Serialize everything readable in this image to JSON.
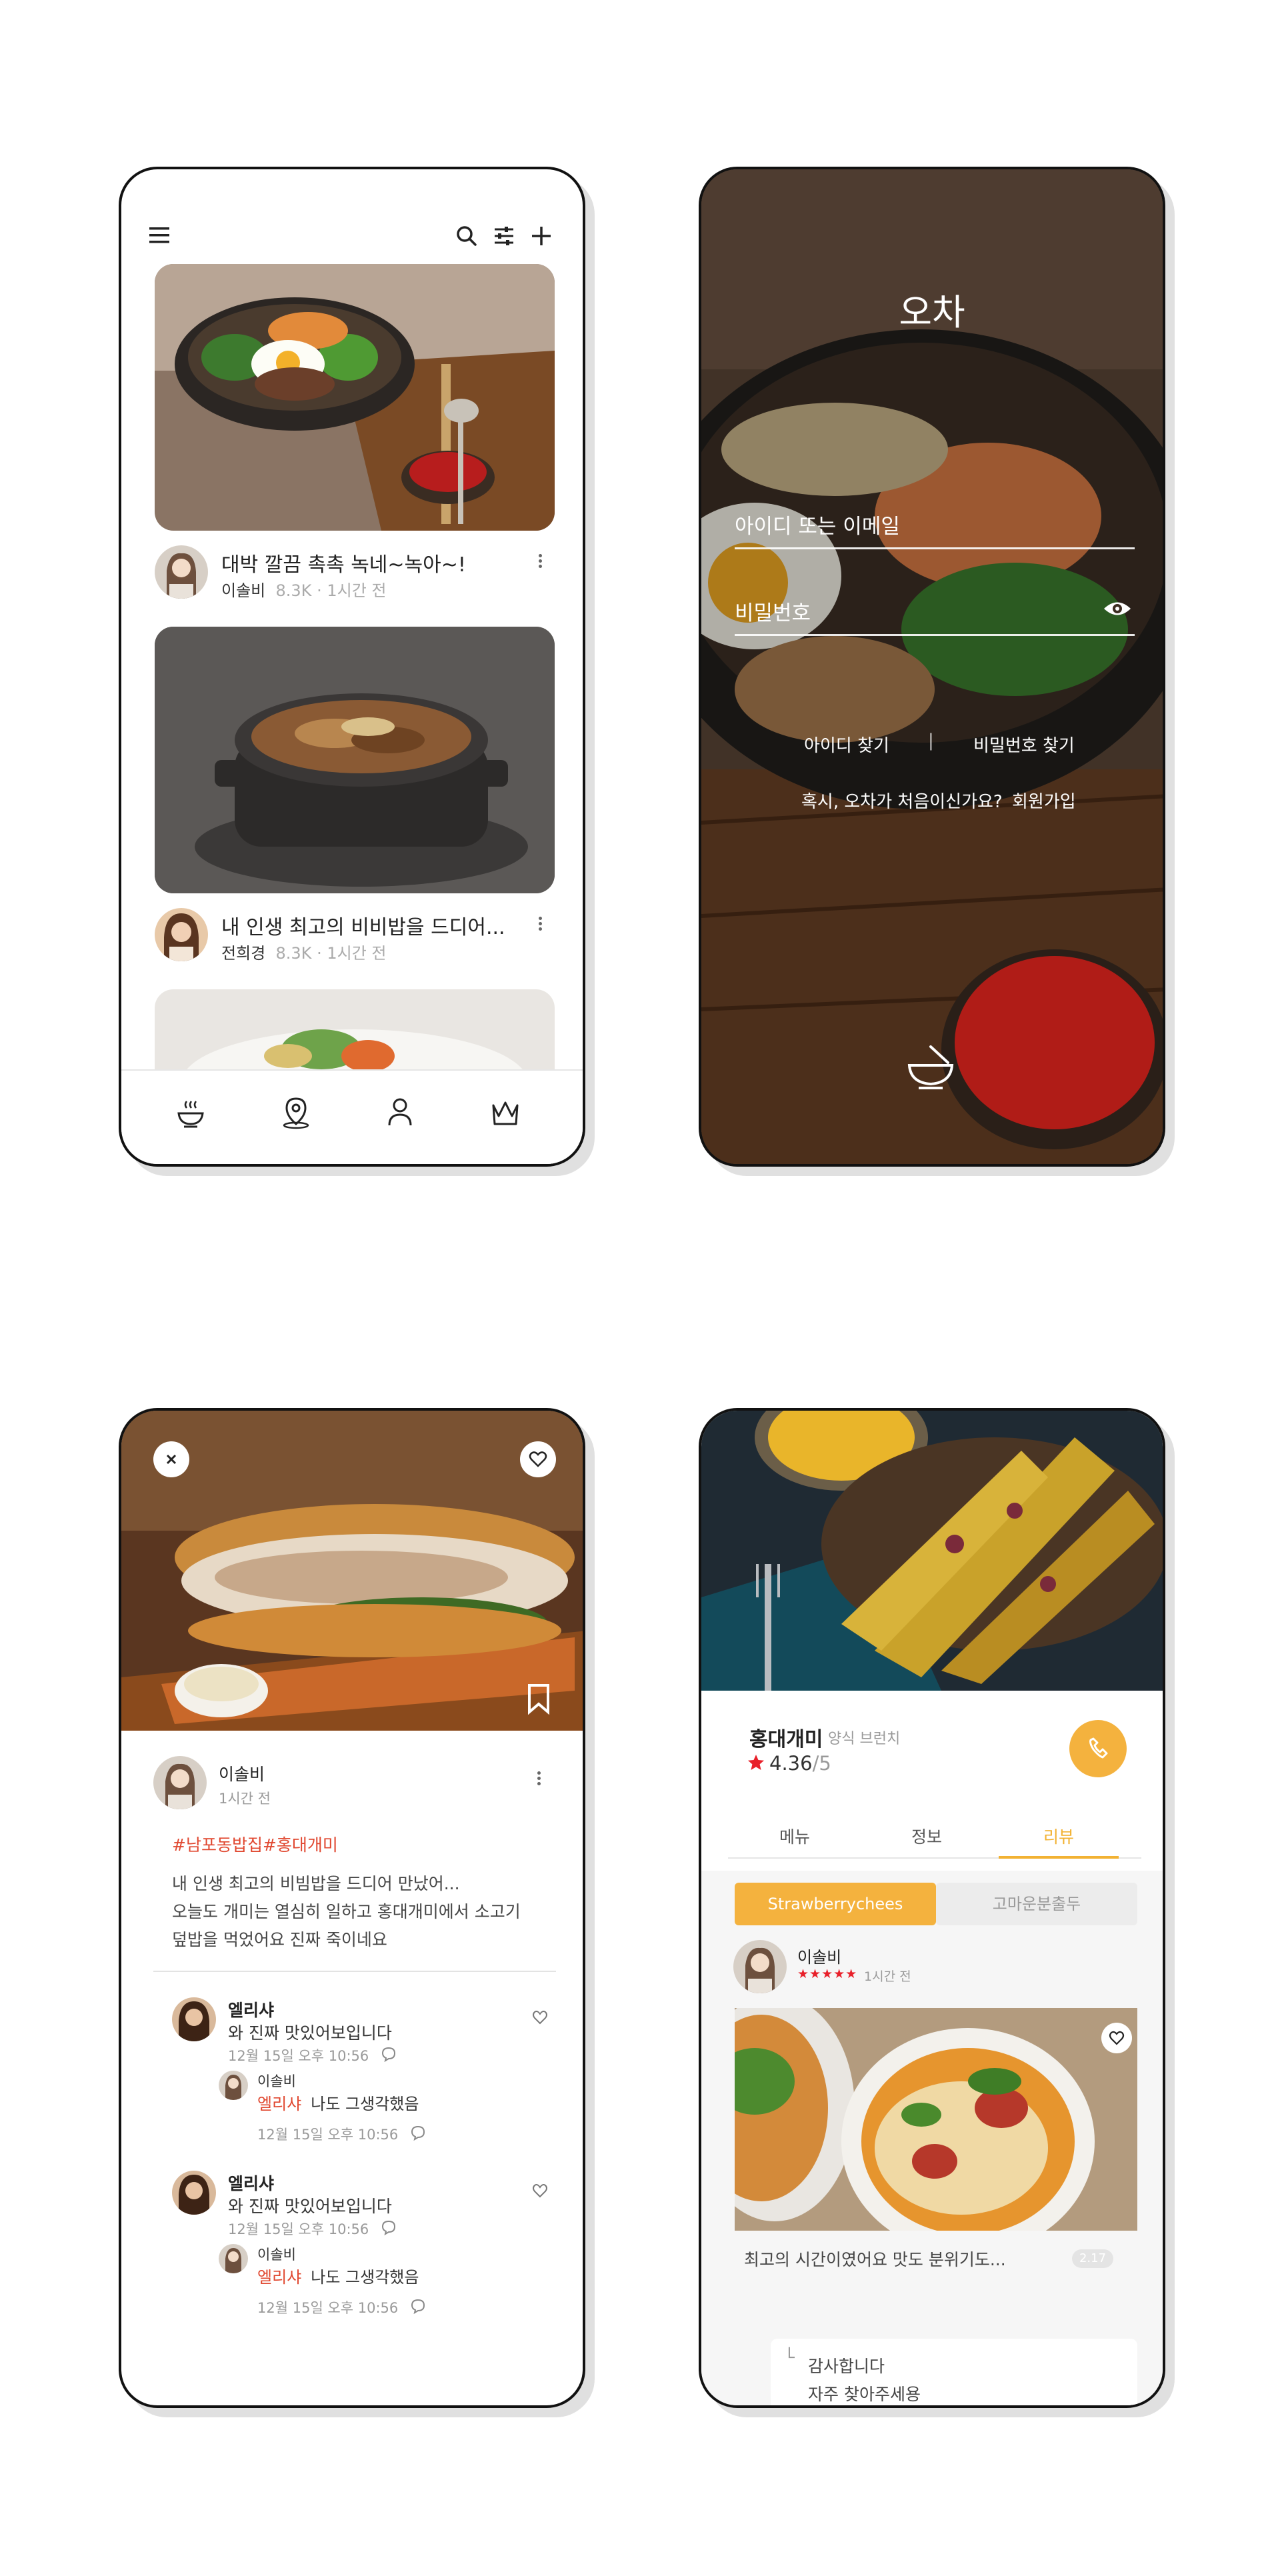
{
  "colors": {
    "accent": "#f4b23e",
    "tag_red": "#e0472f",
    "star_red": "#e8202a",
    "tab_active": "#f2b233"
  },
  "feed": {
    "icons": [
      "menu-icon",
      "search-icon",
      "filter-icon",
      "plus-icon"
    ],
    "posts": [
      {
        "title": "대박 깔끔 촉촉 녹네~녹아~!",
        "author": "이솔비",
        "views": "8.3K",
        "sep": "·",
        "time": "1시간 전"
      },
      {
        "title": "내 인생 최고의 비비밥을 드디어...",
        "author": "전희경",
        "views": "8.3K",
        "sep": "·",
        "time": "1시간 전"
      }
    ],
    "nav": [
      "bowl-icon",
      "map-pin-icon",
      "person-icon",
      "crown-icon"
    ]
  },
  "login": {
    "app_title": "오차",
    "id_placeholder": "아이디 또는 이메일",
    "pw_placeholder": "비밀번호",
    "find_id": "아이디 찾기",
    "divider": "|",
    "find_pw": "비밀번호 찾기",
    "first_time": "혹시, 오차가 처음이신가요?",
    "signup": "회원가입"
  },
  "post": {
    "author": "이솔비",
    "time": "1시간 전",
    "tag1": "#남포동밥집",
    "tag2": "#홍대개미",
    "body": [
      "내 인생 최고의 비빔밥을 드디어 만났어...",
      "오늘도 개미는 열심히 일하고 홍대개미에서 소고기",
      "덮밥을 먹었어요 진짜 죽이네요"
    ],
    "comments": [
      {
        "name": "엘리샤",
        "text": "와 진짜 맛있어보입니다",
        "time": "12월 15일 오후 10:56",
        "reply": {
          "name": "이솔비",
          "mention": "엘리샤",
          "text": "나도 그생각했음",
          "time": "12월 15일 오후 10:56"
        }
      },
      {
        "name": "엘리샤",
        "text": "와 진짜 맛있어보입니다",
        "time": "12월 15일 오후 10:56",
        "reply": {
          "name": "이솔비",
          "mention": "엘리샤",
          "text": "나도 그생각했음",
          "time": "12월 15일 오후 10:56"
        }
      }
    ]
  },
  "restaurant": {
    "name": "홍대개미",
    "branch": "양식 브런치",
    "rating": "4.36",
    "rating_max": "/5",
    "tabs": [
      "메뉴",
      "정보",
      "리뷰"
    ],
    "active_tab": 2,
    "segments": [
      "Strawberrychees",
      "고마운분출두"
    ],
    "review": {
      "author": "이솔비",
      "stars": "★★★★★",
      "time": "1시간 전",
      "text": "최고의 시간이였어요  맛도 분위기도...",
      "badge": "2.17",
      "reply_mark": "└",
      "reply_line1": "감사합니다",
      "reply_line2": "자주 찾아주세용"
    }
  }
}
